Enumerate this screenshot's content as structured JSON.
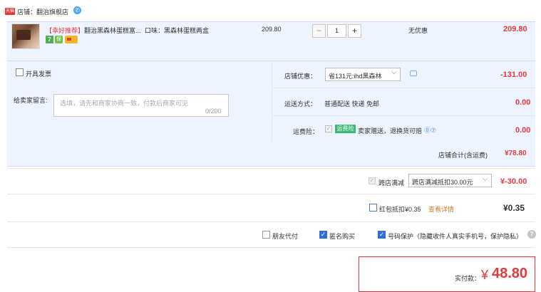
{
  "shop": {
    "badge": "天猫",
    "name": "店铺：翻治旗舰店",
    "chat_icon": "chat-icon"
  },
  "item": {
    "promo_tag": "【幸好推荐】",
    "title": "翻治黑森林蛋糕富...",
    "spec": "口味：黑森林蛋糕两盒",
    "tag_seven": "7",
    "tag_insurance": "保",
    "unit_price": "209.80",
    "quantity": "1",
    "minus": "−",
    "plus": "+",
    "discount": "无优惠",
    "total": "209.80"
  },
  "options": {
    "invoice_label": "开具发票",
    "message_label": "给卖家留言:",
    "message_placeholder": "选填，请先和商家协商一致，付款后商家可见",
    "message_count": "0/200"
  },
  "coupon": {
    "label": "店铺优惠：",
    "selected": "省131元:ihd黑森林",
    "amount": "-131.00"
  },
  "shipping": {
    "label": "运送方式：",
    "text": "普通配送 快递 免邮",
    "amount": "0.00"
  },
  "insurance": {
    "label": "运费险：",
    "tag": "运费险",
    "text": "卖家赠送，退换货可赔",
    "help": "⓪⑦",
    "amount": "0.00"
  },
  "subtotal": {
    "label": "店铺合计(含运费)",
    "amount": "¥78.80"
  },
  "cross_store": {
    "label": "跨店满减",
    "selected": "跨店满减抵扣30.00元",
    "amount": "¥-30.00"
  },
  "red_packet": {
    "label": "红包抵扣¥0.35",
    "link": "查看详情",
    "amount": "¥0.35"
  },
  "checkboxes": {
    "friend_pay": "朋友代付",
    "anonymous": "匿名购买",
    "privacy": "号码保护（隐藏收件人真实手机号，保护隐私）",
    "help": "?"
  },
  "payment": {
    "label": "实付款：",
    "symbol": "¥",
    "amount": "48.80"
  },
  "colors": {
    "accent_red": "#e4393c",
    "panel_blue": "#eef4ff",
    "check_blue": "#2f6fd6"
  }
}
